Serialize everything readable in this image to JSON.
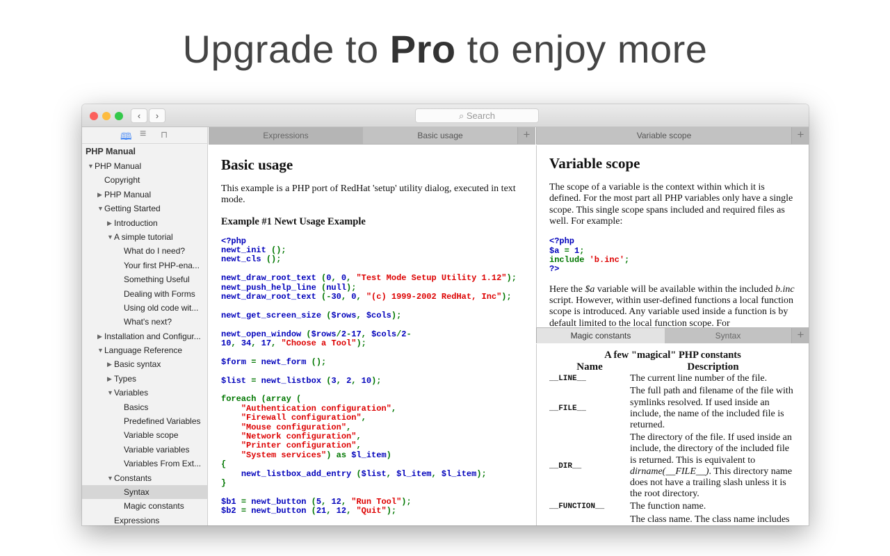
{
  "headline": {
    "pre": "Upgrade to ",
    "bold": "Pro",
    "post": " to enjoy more"
  },
  "titlebar": {
    "back": "‹",
    "forward": "›",
    "search_icon": "search-icon",
    "search_placeholder": "Search"
  },
  "sidebar": {
    "tools": [
      {
        "icon": "book-icon",
        "glyph": "📖",
        "active": true
      },
      {
        "icon": "list-icon",
        "glyph": "≡"
      },
      {
        "icon": "bookmark-icon",
        "glyph": "🔖"
      }
    ],
    "title": "PHP Manual",
    "items": [
      {
        "level": 0,
        "arrow": "open",
        "label": "PHP Manual"
      },
      {
        "level": 1,
        "arrow": "none",
        "label": "Copyright"
      },
      {
        "level": 1,
        "arrow": "closed",
        "label": "PHP Manual"
      },
      {
        "level": 1,
        "arrow": "open",
        "label": "Getting Started"
      },
      {
        "level": 2,
        "arrow": "closed",
        "label": "Introduction"
      },
      {
        "level": 2,
        "arrow": "open",
        "label": "A simple tutorial"
      },
      {
        "level": 3,
        "arrow": "none",
        "label": "What do I need?"
      },
      {
        "level": 3,
        "arrow": "none",
        "label": "Your first PHP-ena..."
      },
      {
        "level": 3,
        "arrow": "none",
        "label": "Something Useful"
      },
      {
        "level": 3,
        "arrow": "none",
        "label": "Dealing with Forms"
      },
      {
        "level": 3,
        "arrow": "none",
        "label": "Using old code wit..."
      },
      {
        "level": 3,
        "arrow": "none",
        "label": "What's next?"
      },
      {
        "level": 1,
        "arrow": "closed",
        "label": "Installation and Configur..."
      },
      {
        "level": 1,
        "arrow": "open",
        "label": "Language Reference"
      },
      {
        "level": 2,
        "arrow": "closed",
        "label": "Basic syntax"
      },
      {
        "level": 2,
        "arrow": "closed",
        "label": "Types"
      },
      {
        "level": 2,
        "arrow": "open",
        "label": "Variables"
      },
      {
        "level": 3,
        "arrow": "none",
        "label": "Basics"
      },
      {
        "level": 3,
        "arrow": "none",
        "label": "Predefined Variables"
      },
      {
        "level": 3,
        "arrow": "none",
        "label": "Variable scope"
      },
      {
        "level": 3,
        "arrow": "none",
        "label": "Variable variables"
      },
      {
        "level": 3,
        "arrow": "none",
        "label": "Variables From Ext..."
      },
      {
        "level": 2,
        "arrow": "open",
        "label": "Constants"
      },
      {
        "level": 3,
        "arrow": "none",
        "label": "Syntax",
        "selected": true
      },
      {
        "level": 3,
        "arrow": "none",
        "label": "Magic constants"
      },
      {
        "level": 2,
        "arrow": "none",
        "label": "Expressions"
      }
    ]
  },
  "left_tabs": {
    "tabs": [
      "Expressions",
      "Basic usage"
    ],
    "active": 1,
    "plus": "+"
  },
  "right_tabs": {
    "tabs": [
      "Variable scope"
    ],
    "plus": "+"
  },
  "lower_tabs": {
    "tabs": [
      "Magic constants",
      "Syntax"
    ],
    "active": 0,
    "plus": "+"
  },
  "basic_usage": {
    "title": "Basic usage",
    "intro": "This example is a PHP port of RedHat 'setup' utility dialog, executed in text mode.",
    "example_title": "Example #1 Newt Usage Example",
    "code": [
      [
        [
          "b",
          "<?php"
        ]
      ],
      [
        [
          "b",
          "newt_init "
        ],
        [
          "g",
          "();"
        ]
      ],
      [
        [
          "b",
          "newt_cls "
        ],
        [
          "g",
          "();"
        ]
      ],
      [],
      [
        [
          "b",
          "newt_draw_root_text "
        ],
        [
          "g",
          "("
        ],
        [
          "b",
          "0"
        ],
        [
          "g",
          ", "
        ],
        [
          "b",
          "0"
        ],
        [
          "g",
          ", "
        ],
        [
          "r",
          "\"Test Mode Setup Utility 1.12\""
        ],
        [
          "g",
          ");"
        ]
      ],
      [
        [
          "b",
          "newt_push_help_line "
        ],
        [
          "g",
          "("
        ],
        [
          "b",
          "null"
        ],
        [
          "g",
          ");"
        ]
      ],
      [
        [
          "b",
          "newt_draw_root_text "
        ],
        [
          "g",
          "(-"
        ],
        [
          "b",
          "30"
        ],
        [
          "g",
          ", "
        ],
        [
          "b",
          "0"
        ],
        [
          "g",
          ", "
        ],
        [
          "r",
          "\"(c) 1999-2002 RedHat, Inc\""
        ],
        [
          "g",
          ");"
        ]
      ],
      [],
      [
        [
          "b",
          "newt_get_screen_size "
        ],
        [
          "g",
          "("
        ],
        [
          "b",
          "$rows"
        ],
        [
          "g",
          ", "
        ],
        [
          "b",
          "$cols"
        ],
        [
          "g",
          ");"
        ]
      ],
      [],
      [
        [
          "b",
          "newt_open_window "
        ],
        [
          "g",
          "("
        ],
        [
          "b",
          "$rows"
        ],
        [
          "g",
          "/"
        ],
        [
          "b",
          "2"
        ],
        [
          "g",
          "-"
        ],
        [
          "b",
          "17"
        ],
        [
          "g",
          ", "
        ],
        [
          "b",
          "$cols"
        ],
        [
          "g",
          "/"
        ],
        [
          "b",
          "2"
        ],
        [
          "g",
          "-"
        ]
      ],
      [
        [
          "b",
          "10"
        ],
        [
          "g",
          ", "
        ],
        [
          "b",
          "34"
        ],
        [
          "g",
          ", "
        ],
        [
          "b",
          "17"
        ],
        [
          "g",
          ", "
        ],
        [
          "r",
          "\"Choose a Tool\""
        ],
        [
          "g",
          ");"
        ]
      ],
      [],
      [
        [
          "b",
          "$form "
        ],
        [
          "g",
          "= "
        ],
        [
          "b",
          "newt_form "
        ],
        [
          "g",
          "();"
        ]
      ],
      [],
      [
        [
          "b",
          "$list "
        ],
        [
          "g",
          "= "
        ],
        [
          "b",
          "newt_listbox "
        ],
        [
          "g",
          "("
        ],
        [
          "b",
          "3"
        ],
        [
          "g",
          ", "
        ],
        [
          "b",
          "2"
        ],
        [
          "g",
          ", "
        ],
        [
          "b",
          "10"
        ],
        [
          "g",
          ");"
        ]
      ],
      [],
      [
        [
          "g",
          "foreach (array ("
        ]
      ],
      [
        [
          "g",
          "    "
        ],
        [
          "r",
          "\"Authentication configuration\""
        ],
        [
          "g",
          ","
        ]
      ],
      [
        [
          "g",
          "    "
        ],
        [
          "r",
          "\"Firewall configuration\""
        ],
        [
          "g",
          ","
        ]
      ],
      [
        [
          "g",
          "    "
        ],
        [
          "r",
          "\"Mouse configuration\""
        ],
        [
          "g",
          ","
        ]
      ],
      [
        [
          "g",
          "    "
        ],
        [
          "r",
          "\"Network configuration\""
        ],
        [
          "g",
          ","
        ]
      ],
      [
        [
          "g",
          "    "
        ],
        [
          "r",
          "\"Printer configuration\""
        ],
        [
          "g",
          ","
        ]
      ],
      [
        [
          "g",
          "    "
        ],
        [
          "r",
          "\"System services\""
        ],
        [
          "g",
          ") as "
        ],
        [
          "b",
          "$l_item"
        ],
        [
          "g",
          ")"
        ]
      ],
      [
        [
          "g",
          "{"
        ]
      ],
      [
        [
          "g",
          "    "
        ],
        [
          "b",
          "newt_listbox_add_entry "
        ],
        [
          "g",
          "("
        ],
        [
          "b",
          "$list"
        ],
        [
          "g",
          ", "
        ],
        [
          "b",
          "$l_item"
        ],
        [
          "g",
          ", "
        ],
        [
          "b",
          "$l_item"
        ],
        [
          "g",
          ");"
        ]
      ],
      [
        [
          "g",
          "}"
        ]
      ],
      [],
      [
        [
          "b",
          "$b1 "
        ],
        [
          "g",
          "= "
        ],
        [
          "b",
          "newt_button "
        ],
        [
          "g",
          "("
        ],
        [
          "b",
          "5"
        ],
        [
          "g",
          ", "
        ],
        [
          "b",
          "12"
        ],
        [
          "g",
          ", "
        ],
        [
          "r",
          "\"Run Tool\""
        ],
        [
          "g",
          ");"
        ]
      ],
      [
        [
          "b",
          "$b2 "
        ],
        [
          "g",
          "= "
        ],
        [
          "b",
          "newt_button "
        ],
        [
          "g",
          "("
        ],
        [
          "b",
          "21"
        ],
        [
          "g",
          ", "
        ],
        [
          "b",
          "12"
        ],
        [
          "g",
          ", "
        ],
        [
          "r",
          "\"Quit\""
        ],
        [
          "g",
          ");"
        ]
      ]
    ]
  },
  "variable_scope": {
    "title": "Variable scope",
    "intro": "The scope of a variable is the context within which it is defined. For the most part all PHP variables only have a single scope. This single scope spans included and required files as well. For example:",
    "code": [
      [
        [
          "b",
          "<?php"
        ]
      ],
      [
        [
          "b",
          "$a "
        ],
        [
          "g",
          "= "
        ],
        [
          "b",
          "1"
        ],
        [
          "g",
          ";"
        ]
      ],
      [
        [
          "g",
          "include "
        ],
        [
          "r",
          "'b.inc'"
        ],
        [
          "g",
          ";"
        ]
      ],
      [
        [
          "b",
          "?>"
        ]
      ]
    ],
    "p2_a": "Here the ",
    "p2_var": "$a",
    "p2_b": " variable will be available within the included ",
    "p2_file": "b.inc",
    "p2_c": " script. However, within user-defined functions a local function scope is introduced. Any variable used inside a function is by default limited to the local function scope. For"
  },
  "magic_constants": {
    "caption": "A few \"magical\" PHP constants",
    "headers": [
      "Name",
      "Description"
    ],
    "rows": [
      {
        "name": "__LINE__",
        "desc": "The current line number of the file."
      },
      {
        "name": "__FILE__",
        "desc": "The full path and filename of the file with symlinks resolved. If used inside an include, the name of the included file is returned."
      },
      {
        "name": "__DIR__",
        "desc": "The directory of the file. If used inside an include, the directory of the included file is returned. This is equivalent to ",
        "desc_italic": "dirname(__FILE__)",
        "desc_after": ". This directory name does not have a trailing slash unless it is the root directory."
      },
      {
        "name": "__FUNCTION__",
        "desc": "The function name."
      },
      {
        "name": "",
        "desc": "The class name. The class name includes"
      }
    ]
  },
  "colors": {
    "keyword": "#0000bb",
    "punct": "#007700",
    "string": "#dd0000",
    "selected_row": "#d6d6d6"
  }
}
